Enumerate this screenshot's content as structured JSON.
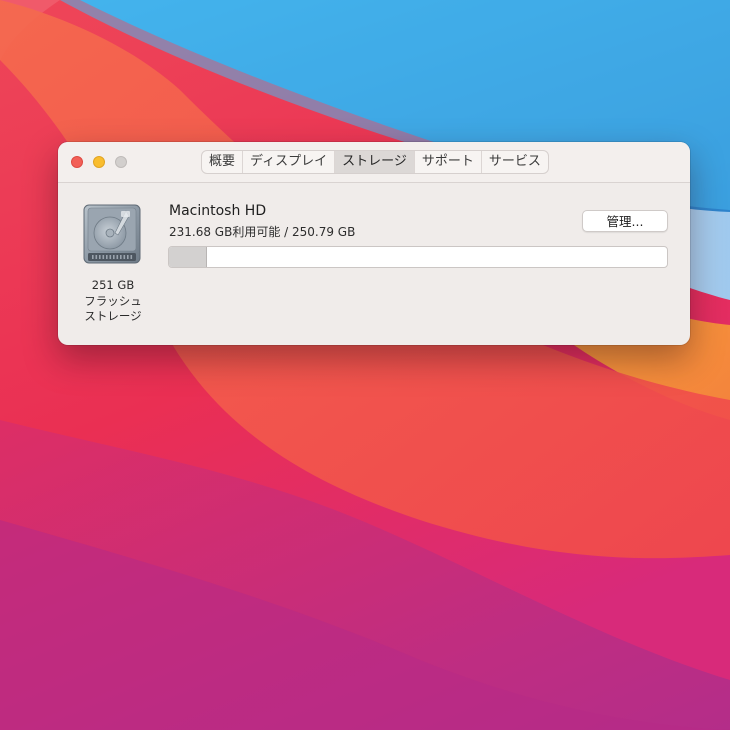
{
  "window": {
    "tabs": [
      {
        "label": "概要",
        "active": false
      },
      {
        "label": "ディスプレイ",
        "active": false
      },
      {
        "label": "ストレージ",
        "active": true
      },
      {
        "label": "サポート",
        "active": false
      },
      {
        "label": "サービス",
        "active": false
      }
    ]
  },
  "disk": {
    "icon": "hard-drive-icon",
    "capacity": "251 GB",
    "type_line1": "フラッシュ",
    "type_line2": "ストレージ"
  },
  "volume": {
    "name": "Macintosh HD",
    "space_text": "231.68 GB利用可能 / 250.79 GB",
    "used_fraction": 0.0762
  },
  "buttons": {
    "manage_label": "管理..."
  },
  "colors": {
    "close": "#f25f57",
    "minimize": "#f9bd2e",
    "zoom": "#d2cfcd",
    "window_bg": "#f0ecea"
  }
}
